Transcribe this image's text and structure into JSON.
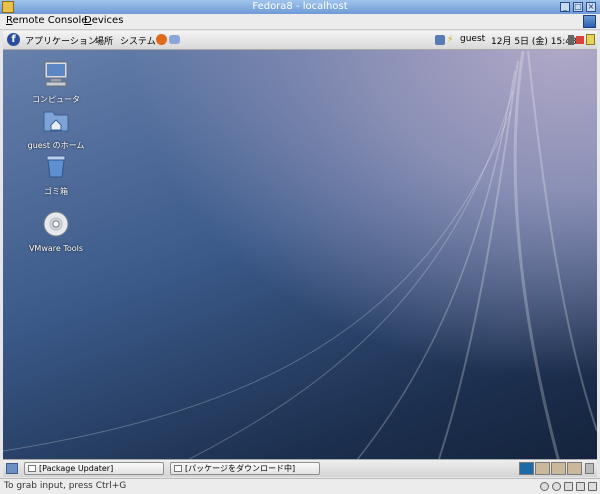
{
  "window": {
    "title": "Fedora8 - localhost"
  },
  "menubar": {
    "items": [
      {
        "label": "Remote Console",
        "accel": "R"
      },
      {
        "label": "Devices",
        "accel": "D"
      }
    ]
  },
  "guest_panel": {
    "menus": [
      "アプリケーション",
      "場所",
      "システム"
    ],
    "user": "guest",
    "datetime": "12月 5日 (金) 15:48"
  },
  "desktop": {
    "icons": [
      {
        "label": "コンピュータ",
        "icon": "computer-icon"
      },
      {
        "label": "guest のホーム",
        "icon": "home-folder-icon"
      },
      {
        "label": "ゴミ箱",
        "icon": "trash-icon"
      },
      {
        "label": "VMware Tools",
        "icon": "cdrom-icon"
      }
    ]
  },
  "taskbar": {
    "tasks": [
      {
        "label": "[Package Updater]"
      },
      {
        "label": "[パッケージをダウンロード中]"
      }
    ],
    "workspace_colors": [
      "#1e6aa6",
      "#c9b99a",
      "#c9b99a",
      "#c9b99a"
    ]
  },
  "statusbar": {
    "text": "To grab input, press Ctrl+G"
  }
}
